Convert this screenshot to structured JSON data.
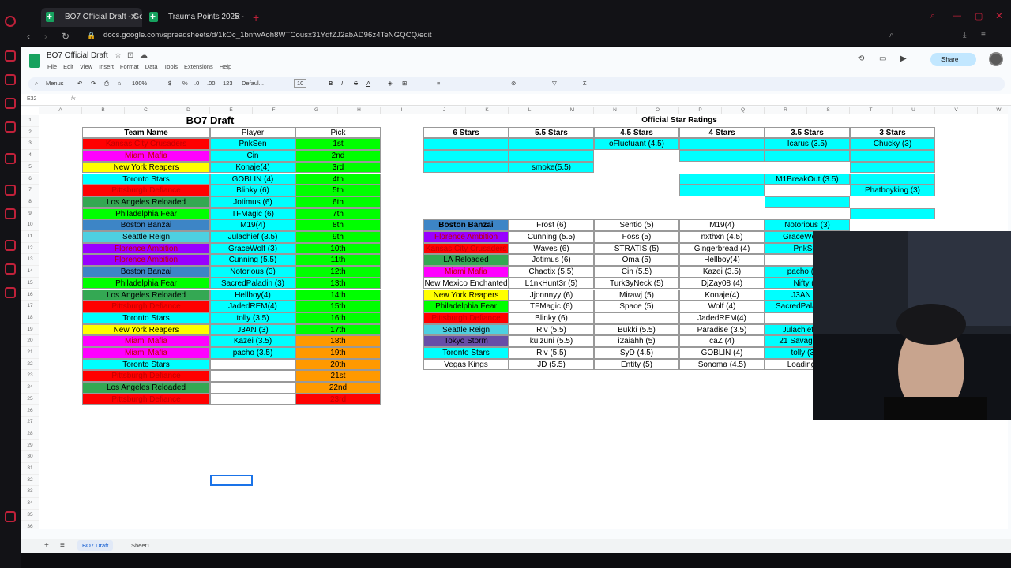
{
  "browser": {
    "tabs": [
      {
        "title": "BO7 Official Draft - Googl"
      },
      {
        "title": "Trauma Points 2025 - Goog"
      }
    ],
    "url": "docs.google.com/spreadsheets/d/1kOc_1bnfwAoh8WTCousx31YdfZJ2abAD96z4TeNGQCQ/edit"
  },
  "sheets": {
    "doc_title": "BO7 Official Draft",
    "menus": [
      "File",
      "Edit",
      "View",
      "Insert",
      "Format",
      "Data",
      "Tools",
      "Extensions",
      "Help"
    ],
    "toolbar": {
      "menus_label": "Menus",
      "zoom": "100%",
      "currency": "$",
      "percent": "%",
      "decimal1": ".0",
      "decimal2": ".00",
      "number_format": "123",
      "font": "Defaul...",
      "font_size": "10"
    },
    "share_label": "Share",
    "name_box": "E32",
    "fx": "fx",
    "columns": [
      "A",
      "B",
      "C",
      "D",
      "E",
      "F",
      "G",
      "H",
      "I",
      "J",
      "K",
      "L",
      "M",
      "N",
      "O",
      "P",
      "Q",
      "R",
      "S",
      "T",
      "U",
      "V",
      "W"
    ],
    "sheet_tabs": [
      "BO7 Draft",
      "Sheet1"
    ],
    "colors": {
      "red": "#ff0000",
      "magenta": "#ff00ff",
      "yellow": "#ffff00",
      "cyan": "#00ffff",
      "darkgreen": "#34a853",
      "green": "#00ff00",
      "steelblue": "#3d85c6",
      "lightcyan": "#4dd0e1",
      "violet": "#9900ff",
      "orange": "#ff9900",
      "purple": "#674ea7",
      "lime": "#6aa84f"
    }
  },
  "draft": {
    "title": "BO7 Draft",
    "headers": {
      "team": "Team Name",
      "player": "Player",
      "pick": "Pick"
    },
    "rows": [
      {
        "team": "Kansas City Crusaders",
        "player": "PnkSen",
        "pick": "1st"
      },
      {
        "team": "Miami Mafia",
        "player": "Cin",
        "pick": "2nd"
      },
      {
        "team": "New York Reapers",
        "player": "Konaje(4)",
        "pick": "3rd"
      },
      {
        "team": "Toronto Stars",
        "player": "GOBLIN (4)",
        "pick": "4th"
      },
      {
        "team": "Pittsburgh Defiance",
        "player": "Blinky (6)",
        "pick": "5th"
      },
      {
        "team": "Los Angeles Reloaded",
        "player": "Jotimus (6)",
        "pick": "6th"
      },
      {
        "team": "Philadelphia Fear",
        "player": "TFMagic (6)",
        "pick": "7th"
      },
      {
        "team": "Boston Banzai",
        "player": "M19(4)",
        "pick": "8th"
      },
      {
        "team": "Seattle Reign",
        "player": "Julachief (3.5)",
        "pick": "9th"
      },
      {
        "team": "Florence Ambition",
        "player": "GraceWolf (3)",
        "pick": "10th"
      },
      {
        "team": "Florence Ambition",
        "player": "Cunning (5.5)",
        "pick": "11th"
      },
      {
        "team": "Boston Banzai",
        "player": "Notorious (3)",
        "pick": "12th"
      },
      {
        "team": "Philadelphia Fear",
        "player": "SacredPaladin (3)",
        "pick": "13th"
      },
      {
        "team": "Los Angeles Reloaded",
        "player": "Hellboy(4)",
        "pick": "14th"
      },
      {
        "team": "Pittsburgh Defiance",
        "player": "JadedREM(4)",
        "pick": "15th"
      },
      {
        "team": "Toronto Stars",
        "player": "tolly (3.5)",
        "pick": "16th"
      },
      {
        "team": "New York Reapers",
        "player": "J3AN (3)",
        "pick": "17th"
      },
      {
        "team": "Miami Mafia",
        "player": "Kazei (3.5)",
        "pick": "18th"
      },
      {
        "team": "Miami Mafia",
        "player": "pacho (3.5)",
        "pick": "19th"
      },
      {
        "team": "Toronto Stars",
        "player": "",
        "pick": "20th"
      },
      {
        "team": "Pittsburgh Defiance",
        "player": "",
        "pick": "21st"
      },
      {
        "team": "Los Angeles Reloaded",
        "player": "",
        "pick": "22nd"
      },
      {
        "team": "Pittsburgh Defiance",
        "player": "",
        "pick": "23rd"
      }
    ]
  },
  "ratings": {
    "title": "Official Star Ratings",
    "tiers": [
      "6 Stars",
      "5.5 Stars",
      "4.5 Stars",
      "4 Stars",
      "3.5 Stars",
      "3 Stars"
    ],
    "tier_rows": [
      [
        "",
        "",
        "oFluctuant (4.5)",
        "",
        "Icarus (3.5)",
        "Chucky (3)"
      ],
      [
        "",
        "",
        "",
        "",
        "",
        ""
      ],
      [
        "",
        "smoke(5.5)",
        "",
        "",
        "",
        ""
      ],
      [
        "",
        "",
        "",
        "",
        "M1BreakOut (3.5)",
        ""
      ],
      [
        "",
        "",
        "",
        "",
        "",
        "Phatboyking (3)"
      ],
      [
        "",
        "",
        "",
        "",
        "",
        ""
      ],
      [
        "",
        "",
        "",
        "",
        "",
        ""
      ]
    ]
  },
  "rosters": {
    "rows": [
      {
        "team": "Boston Banzai",
        "p": [
          "Frost (6)",
          "Sentio (5)",
          "M19(4)",
          "Notorious (3)"
        ]
      },
      {
        "team": "Florence Ambition",
        "p": [
          "Cunning (5.5)",
          "Foss (5)",
          "nxthxn (4.5)",
          "GraceWolf (3)"
        ]
      },
      {
        "team": "Kansas City Crusaders",
        "p": [
          "Waves (6)",
          "STRATIS (5)",
          "Gingerbread (4)",
          "PnkSen"
        ]
      },
      {
        "team": "LA Reloaded",
        "p": [
          "Jotimus (6)",
          "Oma (5)",
          "Hellboy(4)",
          ""
        ]
      },
      {
        "team": "Miami Mafia",
        "p": [
          "Chaotix (5.5)",
          "Cin (5.5)",
          "Kazei (3.5)",
          "pacho (3.5)"
        ]
      },
      {
        "team": "New Mexico Enchanted",
        "p": [
          "L1nkHunt3r (5)",
          "Turk3yNeck (5)",
          "DjZay08 (4)",
          "Nifty (3)"
        ]
      },
      {
        "team": "New York Reapers",
        "p": [
          "Jjonnnyy (6)",
          "Mirawj (5)",
          "Konaje(4)",
          "J3AN (3)"
        ]
      },
      {
        "team": "Philadelphia Fear",
        "p": [
          "TFMagic (6)",
          "Space (5)",
          "Wolf (4)",
          "SacredPaladin (3)"
        ]
      },
      {
        "team": "Pittsburgh Defiance",
        "p": [
          "Blinky (6)",
          "",
          "JadedREM(4)",
          ""
        ]
      },
      {
        "team": "Seattle Reign",
        "p": [
          "Riv (5.5)",
          "Bukki (5.5)",
          "Paradise (3.5)",
          "Julachief (3.5)"
        ]
      },
      {
        "team": "Tokyo Storm",
        "p": [
          "kulzuni (5.5)",
          "i2aiahh (5)",
          "caZ (4)",
          "21 Savage (3.5)"
        ]
      },
      {
        "team": "Toronto Stars",
        "p": [
          "Riv (5.5)",
          "SyD (4.5)",
          "GOBLIN (4)",
          "tolly (3.5)"
        ]
      },
      {
        "team": "Vegas Kings",
        "p": [
          "JD (5.5)",
          "Entity (5)",
          "Sonoma (4.5)",
          "Loading (3)"
        ]
      }
    ]
  }
}
